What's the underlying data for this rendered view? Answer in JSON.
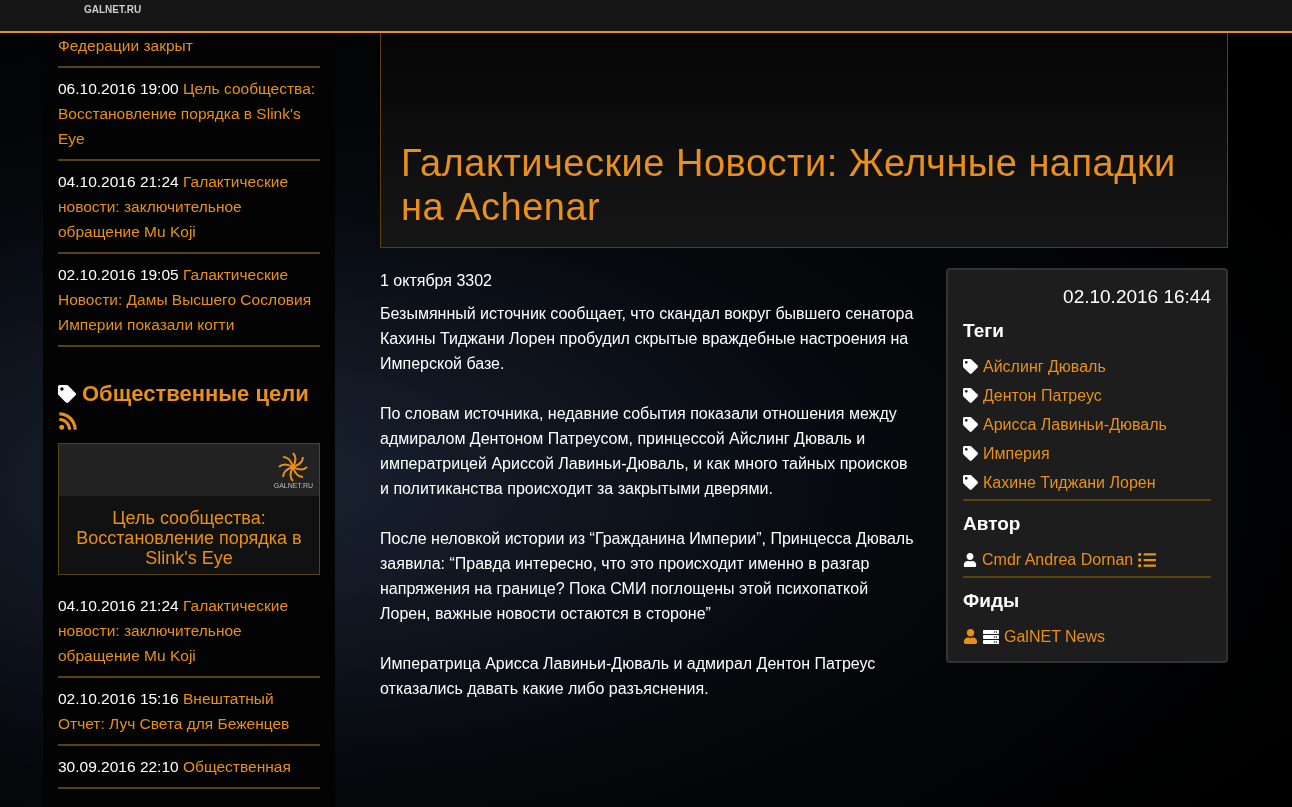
{
  "header": {
    "logo_text": "GALNET.RU"
  },
  "sidebar": {
    "top_fragment": "Федерации закрыт",
    "news": [
      {
        "date": "06.10.2016 19:00",
        "title": "Цель сообщества: Восстановление порядка в Slink's Eye"
      },
      {
        "date": "04.10.2016 21:24",
        "title": "Галактические новости: заключительное обращение Mu Koji"
      },
      {
        "date": "02.10.2016 19:05",
        "title": "Галактические Новости: Дамы Высшего Сословия Империи показали когти"
      }
    ],
    "section_title": "Общественные цели",
    "featured": {
      "logo_text": "GALNET.RU",
      "title": "Цель сообщества: Восстановление порядка в Slink's Eye"
    },
    "news2": [
      {
        "date": "04.10.2016 21:24",
        "title": "Галактические новости: заключительное обращение Mu Koji"
      },
      {
        "date": "02.10.2016 15:16",
        "title": "Внештатный Отчет: Луч Света для Беженцев"
      },
      {
        "date": "30.09.2016 22:10",
        "title": "Общественная"
      }
    ]
  },
  "article": {
    "title": "Галактические Новости: Желчные нападки на Achenar",
    "date": "1 октября 3302",
    "paragraphs": [
      "Безымянный источник сообщает, что скандал вокруг бывшего сенатора Кахины Тиджани Лорен пробудил скрытые враждебные настроения на Имперской базе.",
      "По словам источника, недавние события показали отношения между адмиралом Дентоном Патреусом, принцессой Айслинг Дюваль и императрицей Ариссой Лавиньи-Дюваль, и как много тайных происков и политиканства происходит за закрытыми дверями.",
      "После неловкой истории из “Гражданина Империи”, Принцесса Дюваль заявила: “Правда интересно, что это происходит именно в разгар напряжения на границе? Пока СМИ поглощены этой психопаткой Лорен, важные новости остаются в стороне”",
      "Императрица Арисса Лавиньи-Дюваль и адмирал Дентон Патреус отказались давать какие либо разъяснения."
    ]
  },
  "info": {
    "datetime": "02.10.2016 16:44",
    "tags_heading": "Теги",
    "tags": [
      "Айслинг Дюваль",
      "Дентон Патреус",
      "Арисса Лавиньи-Дюваль",
      "Империя",
      "Кахине Тиджани Лорен"
    ],
    "author_heading": "Автор",
    "author": "Cmdr Andrea Dornan",
    "feeds_heading": "Фиды",
    "feed": "GalNET News"
  }
}
